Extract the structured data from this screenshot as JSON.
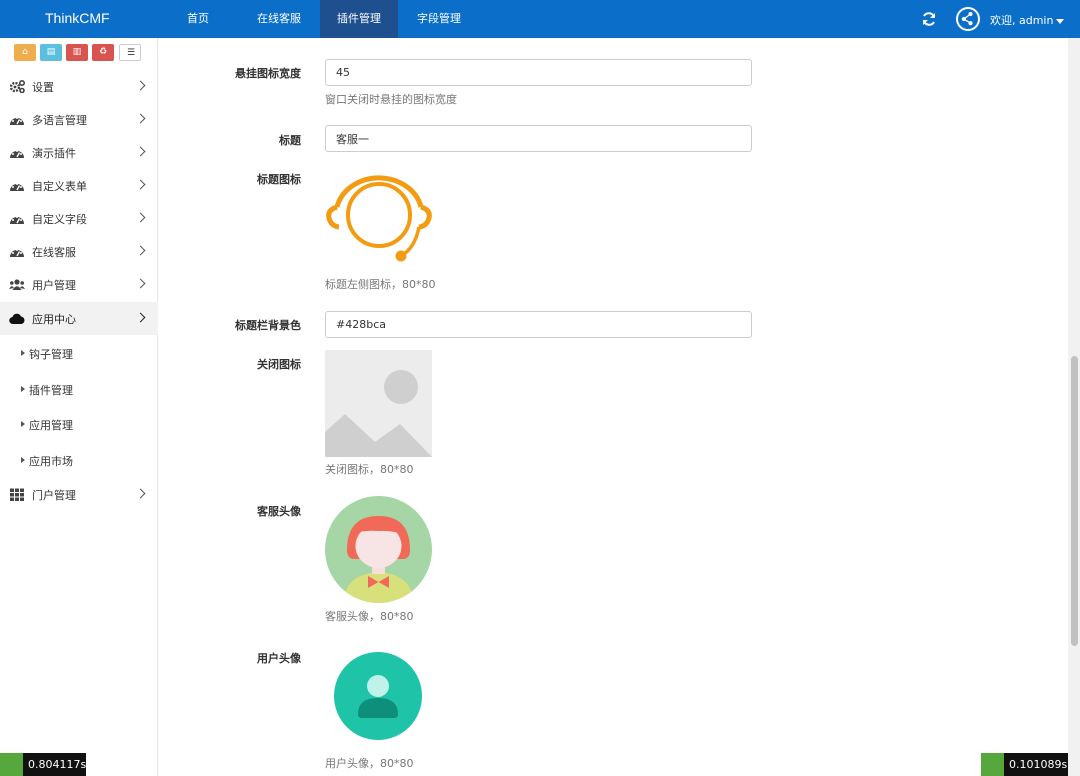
{
  "navbar": {
    "brand": "ThinkCMF",
    "items": [
      {
        "label": "首页"
      },
      {
        "label": "在线客服"
      },
      {
        "label": "插件管理"
      },
      {
        "label": "字段管理"
      }
    ],
    "user_label": "欢迎, admin"
  },
  "sidebar": {
    "items": [
      {
        "label": "设置",
        "icon": "gears-icon"
      },
      {
        "label": "多语言管理",
        "icon": "dashboard-icon"
      },
      {
        "label": "演示插件",
        "icon": "dashboard-icon"
      },
      {
        "label": "自定义表单",
        "icon": "dashboard-icon"
      },
      {
        "label": "自定义字段",
        "icon": "dashboard-icon"
      },
      {
        "label": "在线客服",
        "icon": "dashboard-icon"
      },
      {
        "label": "用户管理",
        "icon": "users-icon"
      },
      {
        "label": "应用中心",
        "icon": "cloud-icon"
      }
    ],
    "subitems": [
      {
        "label": "钩子管理"
      },
      {
        "label": "插件管理"
      },
      {
        "label": "应用管理"
      },
      {
        "label": "应用市场"
      }
    ],
    "last_item": {
      "label": "门户管理",
      "icon": "grid-icon"
    }
  },
  "form": {
    "icon_width": {
      "label": "悬挂图标宽度",
      "value": "45",
      "help": "窗口关闭时悬挂的图标宽度"
    },
    "title": {
      "label": "标题",
      "value": "客服一"
    },
    "title_icon": {
      "label": "标题图标",
      "help": "标题左侧图标，80*80"
    },
    "title_bg": {
      "label": "标题栏背景色",
      "value": "#428bca"
    },
    "close_icon": {
      "label": "关闭图标",
      "help": "关闭图标，80*80"
    },
    "service_avatar": {
      "label": "客服头像",
      "help": "客服头像，80*80"
    },
    "user_avatar": {
      "label": "用户头像",
      "help": "用户头像，80*80"
    }
  },
  "debug": {
    "left": "0.804117s",
    "right": "0.101089s"
  },
  "colors": {
    "navbar": "#0b6fca",
    "navbar_active": "#1e4f8f",
    "headset": "#f39c12",
    "user_avatar": "#1fc3a8"
  }
}
